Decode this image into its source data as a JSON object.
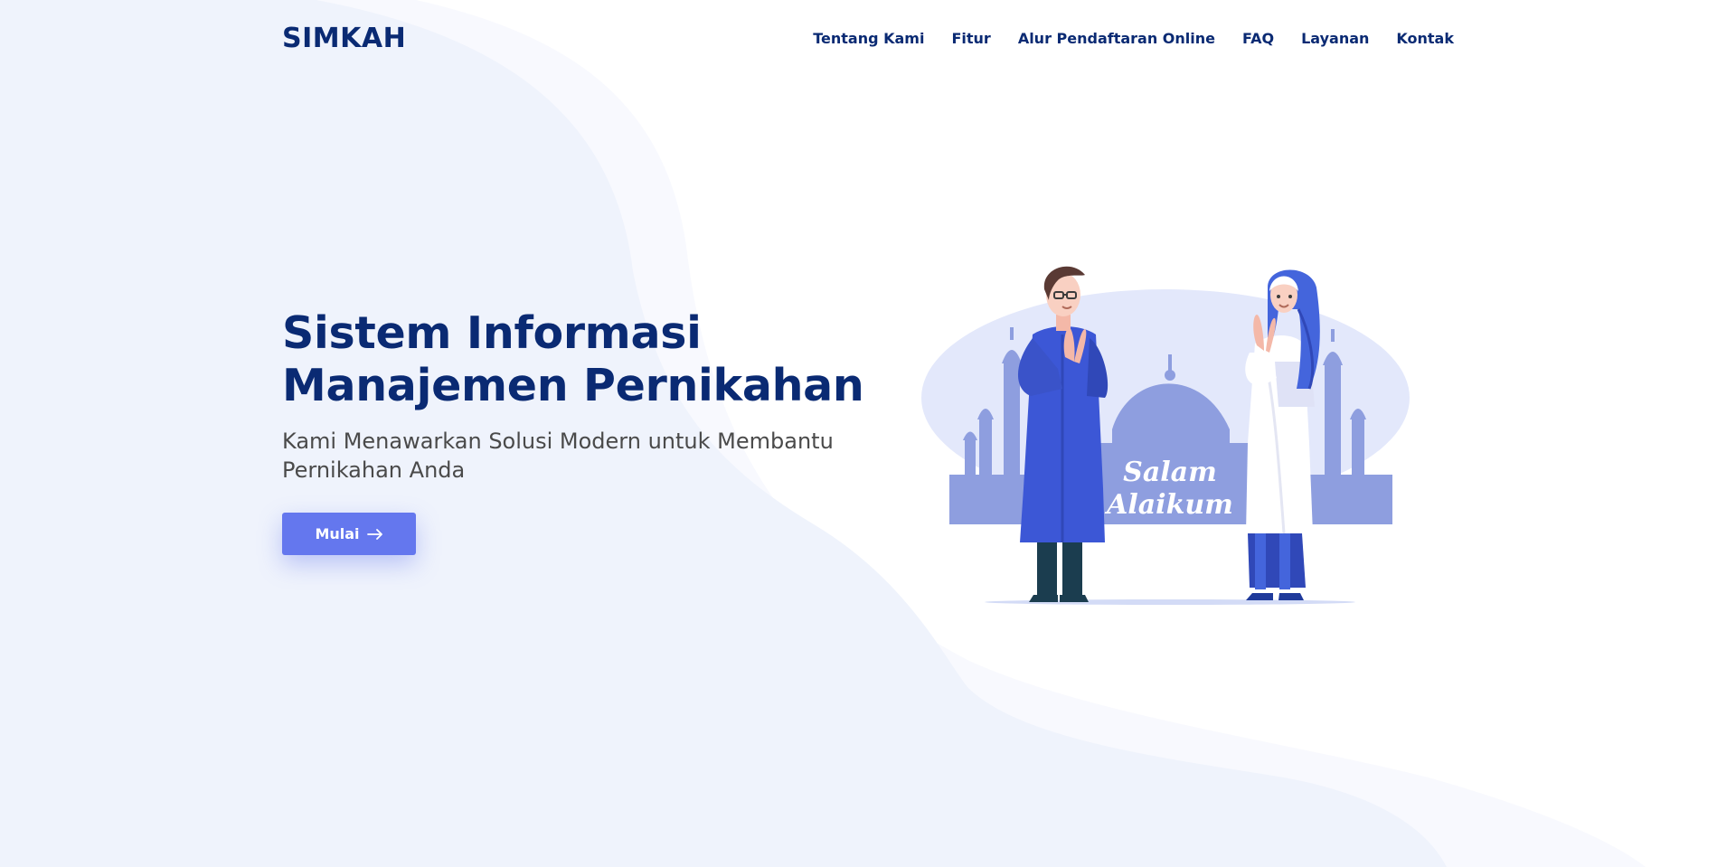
{
  "brand": {
    "name": "SIMKAH"
  },
  "nav": {
    "items": [
      {
        "label": "Tentang Kami"
      },
      {
        "label": "Fitur"
      },
      {
        "label": "Alur Pendaftaran Online"
      },
      {
        "label": "FAQ"
      },
      {
        "label": "Layanan"
      },
      {
        "label": "Kontak"
      }
    ]
  },
  "hero": {
    "title_line1": "Sistem Informasi",
    "title_line2": "Manajemen Pernikahan",
    "subtitle": "Kami Menawarkan Solusi Modern untuk Membantu Pernikahan Anda",
    "cta_label": "Mulai",
    "cta_icon": "arrow-right-icon"
  },
  "illustration": {
    "greeting_line1": "Salam",
    "greeting_line2": "Alaikum"
  },
  "colors": {
    "brand": "#0a2a73",
    "accent": "#6477ee",
    "background_wave": "#eff3fc",
    "text_muted": "#4a4a4a"
  }
}
